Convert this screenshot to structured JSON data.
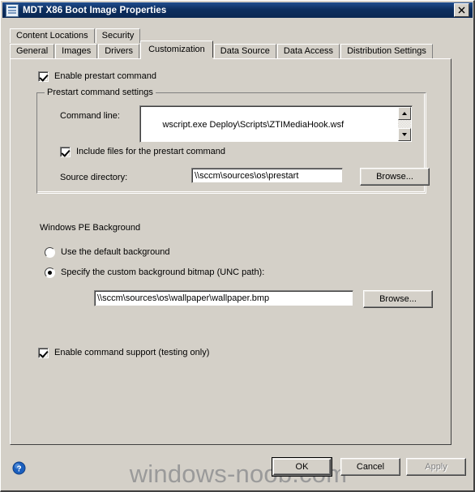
{
  "window": {
    "title": "MDT X86 Boot Image Properties",
    "icon": "properties-document-icon",
    "close_label": "✕"
  },
  "tabs": {
    "row_top": [
      {
        "label": "Content Locations",
        "selected": false
      },
      {
        "label": "Security",
        "selected": false
      }
    ],
    "row_bottom": [
      {
        "label": "General",
        "selected": false
      },
      {
        "label": "Images",
        "selected": false
      },
      {
        "label": "Drivers",
        "selected": false
      },
      {
        "label": "Customization",
        "selected": true
      },
      {
        "label": "Data Source",
        "selected": false
      },
      {
        "label": "Data Access",
        "selected": false
      },
      {
        "label": "Distribution Settings",
        "selected": false
      }
    ]
  },
  "customization": {
    "enable_prestart_command": {
      "label": "Enable prestart command",
      "checked": true
    },
    "prestart_group": {
      "title": "Prestart command settings",
      "command_line_label": "Command line:",
      "command_line_value": "wscript.exe Deploy\\Scripts\\ZTIMediaHook.wsf",
      "include_files": {
        "label": "Include files for the prestart command",
        "checked": true
      },
      "source_directory_label": "Source directory:",
      "source_directory_value": "\\\\sccm\\sources\\os\\prestart",
      "browse_label": "Browse..."
    },
    "winpe_background": {
      "title": "Windows PE Background",
      "option_default": {
        "label": "Use the default background",
        "selected": false
      },
      "option_custom": {
        "label": "Specify the custom background bitmap (UNC path):",
        "selected": true
      },
      "bitmap_path_value": "\\\\sccm\\sources\\os\\wallpaper\\wallpaper.bmp",
      "browse_label": "Browse..."
    },
    "enable_command_support": {
      "label": "Enable command support (testing only)",
      "checked": true
    }
  },
  "footer": {
    "help_icon": "help-question-icon",
    "ok_label": "OK",
    "cancel_label": "Cancel",
    "apply_label": "Apply",
    "apply_disabled": true
  },
  "watermark": {
    "text": "windows-noob.com"
  },
  "colors": {
    "titlebar": "#0d2f60",
    "dialog_face": "#d4d0c8",
    "field_bg": "#ffffff",
    "disabled_text": "#808080",
    "watermark": "#9a9a9a"
  }
}
